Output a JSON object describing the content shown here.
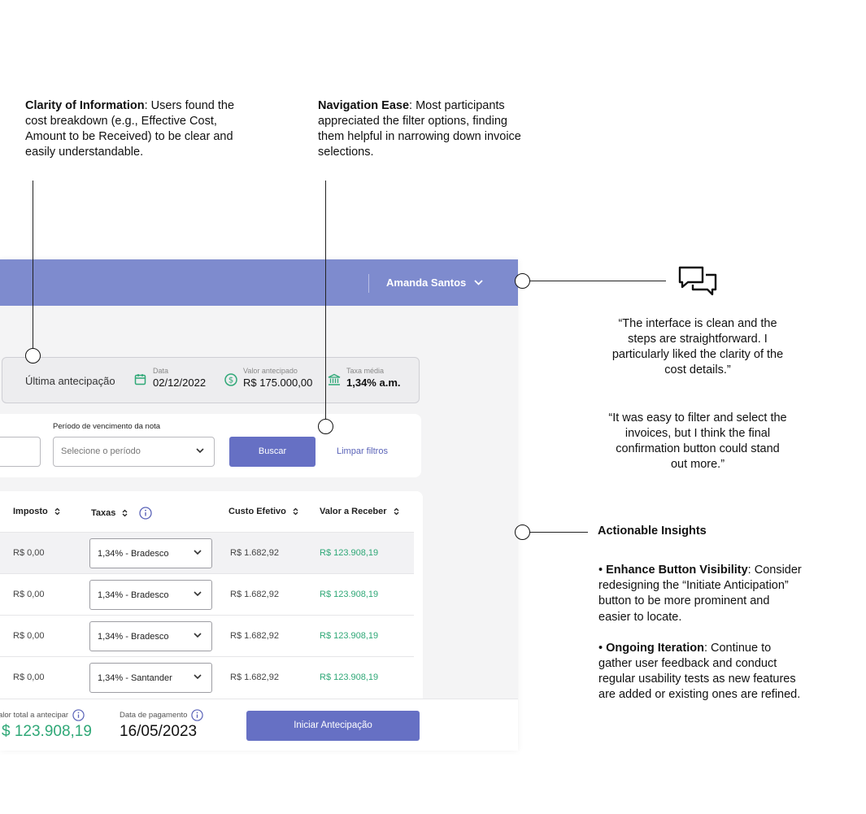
{
  "notes": {
    "clarity": {
      "title": "Clarity of Information",
      "text": ": Users found the cost breakdown (e.g., Effective Cost, Amount to be Received) to be clear and easily understandable."
    },
    "navigation": {
      "title": "Navigation Ease",
      "text": ": Most participants appreciated the filter options, finding them helpful in narrowing down invoice selections."
    }
  },
  "header": {
    "user_name": "Amanda Santos"
  },
  "last_card": {
    "title": "Última antecipação",
    "date_label": "Data",
    "date_value": "02/12/2022",
    "amount_label": "Valor antecipado",
    "amount_value": "R$ 175.000,00",
    "rate_label": "Taxa média",
    "rate_value": "1,34% a.m."
  },
  "filters": {
    "period_label": "Período de vencimento da nota",
    "period_placeholder": "Selecione o período",
    "search_label": "Buscar",
    "clear_label": "Limpar filtros"
  },
  "table": {
    "columns": [
      "Imposto",
      "Taxas",
      "Custo Efetivo",
      "Valor a Receber"
    ],
    "rows": [
      {
        "imposto": "R$ 0,00",
        "taxa": "1,34% - Bradesco",
        "custo": "R$ 1.682,92",
        "valor": "R$ 123.908,19"
      },
      {
        "imposto": "R$ 0,00",
        "taxa": "1,34% - Bradesco",
        "custo": "R$ 1.682,92",
        "valor": "R$ 123.908,19"
      },
      {
        "imposto": "R$ 0,00",
        "taxa": "1,34% - Bradesco",
        "custo": "R$ 1.682,92",
        "valor": "R$ 123.908,19"
      },
      {
        "imposto": "R$ 0,00",
        "taxa": "1,34% - Santander",
        "custo": "R$ 1.682,92",
        "valor": "R$ 123.908,19"
      }
    ]
  },
  "footer": {
    "total_label": "alor total a antecipar",
    "total_value": "$ 123.908,19",
    "date_label": "Data de pagamento",
    "date_value": "16/05/2023",
    "button_label": "Iniciar Antecipação"
  },
  "quotes": [
    "“The interface is clean and the steps are straightforward. I particularly liked the clarity of the cost details.”",
    "“It was easy to filter and select the invoices, but I think the final confirmation button could stand out more.”"
  ],
  "insights": {
    "title": "Actionable Insights",
    "items": [
      {
        "title": "Enhance Button Visibility",
        "text": ": Consider redesigning the “Initiate Anticipation” button to be more prominent and easier to locate."
      },
      {
        "title": "Ongoing Iteration",
        "text": ": Continue to gather user feedback and conduct regular usability tests as new features are added or existing ones are refined."
      }
    ]
  },
  "colors": {
    "header": "#7e8bce",
    "primary": "#6670c4",
    "green": "#2fa877"
  }
}
